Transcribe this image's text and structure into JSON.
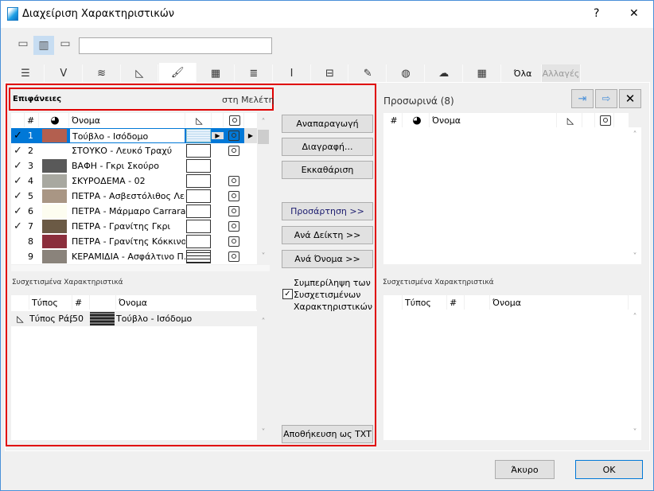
{
  "window": {
    "title": "Διαχείριση Χαρακτηριστικών",
    "help": "?",
    "close": "✕"
  },
  "search": {
    "value": "",
    "placeholder": ""
  },
  "tabs": [
    {
      "icon": "layers-icon",
      "glyph": "☰"
    },
    {
      "icon": "pen-icon",
      "glyph": "Ⅴ"
    },
    {
      "icon": "line-type-icon",
      "glyph": "≋"
    },
    {
      "icon": "fill-icon",
      "glyph": "◺"
    },
    {
      "icon": "surface-brush-icon",
      "glyph": "🖌",
      "active": true
    },
    {
      "icon": "building-material-icon",
      "glyph": "▦"
    },
    {
      "icon": "composite-icon",
      "glyph": "≣"
    },
    {
      "icon": "profile-icon",
      "glyph": "Ι"
    },
    {
      "icon": "zone-icon",
      "glyph": "⊟"
    },
    {
      "icon": "markup-icon",
      "glyph": "✎"
    },
    {
      "icon": "globe-icon",
      "glyph": "◍"
    },
    {
      "icon": "operation-profile-icon",
      "glyph": "☁"
    },
    {
      "icon": "grid-icon",
      "glyph": "▦"
    }
  ],
  "tab_all": "Όλα",
  "tab_changes": "Αλλαγές",
  "left": {
    "title": "Επιφάνειες",
    "source": "στη Μελέτη",
    "columns": {
      "num": "#",
      "name": "Όνομα"
    },
    "rows": [
      {
        "checked": true,
        "num": "1",
        "color": "#b35f4f",
        "name": "Τούβλο - Ισόδομο",
        "fill": "dots",
        "image": true,
        "selected": true
      },
      {
        "checked": true,
        "num": "2",
        "color": "#ffffff",
        "name": "ΣΤΟΥΚΟ - Λευκό Τραχύ",
        "fill": "empty",
        "image": true
      },
      {
        "checked": true,
        "num": "3",
        "color": "#595959",
        "name": "ΒΑΦΗ - Γκρι Σκούρο",
        "fill": "empty",
        "image": false
      },
      {
        "checked": true,
        "num": "4",
        "color": "#a8a8a0",
        "name": "ΣΚΥΡΟΔΕΜΑ - 02",
        "fill": "empty",
        "image": true
      },
      {
        "checked": true,
        "num": "5",
        "color": "#a99684",
        "name": "ΠΕΤΡΑ - Ασβεστόλιθος Λείος",
        "fill": "empty",
        "image": true
      },
      {
        "checked": true,
        "num": "6",
        "color": "#fdfdf0",
        "name": "ΠΕΤΡΑ - Μάρμαρο Carrara ...",
        "fill": "empty",
        "image": true
      },
      {
        "checked": true,
        "num": "7",
        "color": "#6b5a45",
        "name": "ΠΕΤΡΑ - Γρανίτης Γκρι",
        "fill": "empty",
        "image": true
      },
      {
        "checked": false,
        "num": "8",
        "color": "#8b2e3c",
        "name": "ΠΕΤΡΑ - Γρανίτης Κόκκινος",
        "fill": "empty",
        "image": true
      },
      {
        "checked": false,
        "num": "9",
        "color": "#8a837b",
        "name": "ΚΕΡΑΜΙΔΙΑ - Ασφάλτινο Π...",
        "fill": "brick",
        "image": true
      }
    ],
    "assoc_title": "Συσχετισμένα Χαρακτηριστικά",
    "assoc_columns": {
      "type": "Τύπος",
      "num": "#",
      "name": "Όνομα"
    },
    "assoc_rows": [
      {
        "type": "Τύπος Ράβδωσης",
        "num": "50",
        "name": "Τούβλο - Ισόδομο"
      }
    ]
  },
  "middle": {
    "duplicate": "Αναπαραγωγή",
    "delete": "Διαγραφή...",
    "purge": "Εκκαθάριση",
    "append": "Προσάρτηση >>",
    "by_index": "Ανά Δείκτη >>",
    "by_name": "Ανά Όνομα >>",
    "include_assoc": "Συμπερίληψη των Συσχετισμένων Χαρακτηριστικών",
    "include_line1": "Συμπερίληψη των",
    "include_line2": "Συσχετισμένων",
    "include_line3": "Χαρακτηριστικών",
    "include_checked": true,
    "save_txt": "Αποθήκευση ως TXT"
  },
  "right": {
    "title": "Προσωρινά (8)",
    "columns": {
      "num": "#",
      "name": "Όνομα"
    },
    "assoc_title": "Συσχετισμένα Χαρακτηριστικά",
    "assoc_columns": {
      "type": "Τύπος",
      "num": "#",
      "name": "Όνομα"
    }
  },
  "footer": {
    "cancel": "Άκυρο",
    "ok": "OK"
  },
  "colors": {
    "selection": "#0078d7",
    "highlight_border": "#e00000"
  }
}
